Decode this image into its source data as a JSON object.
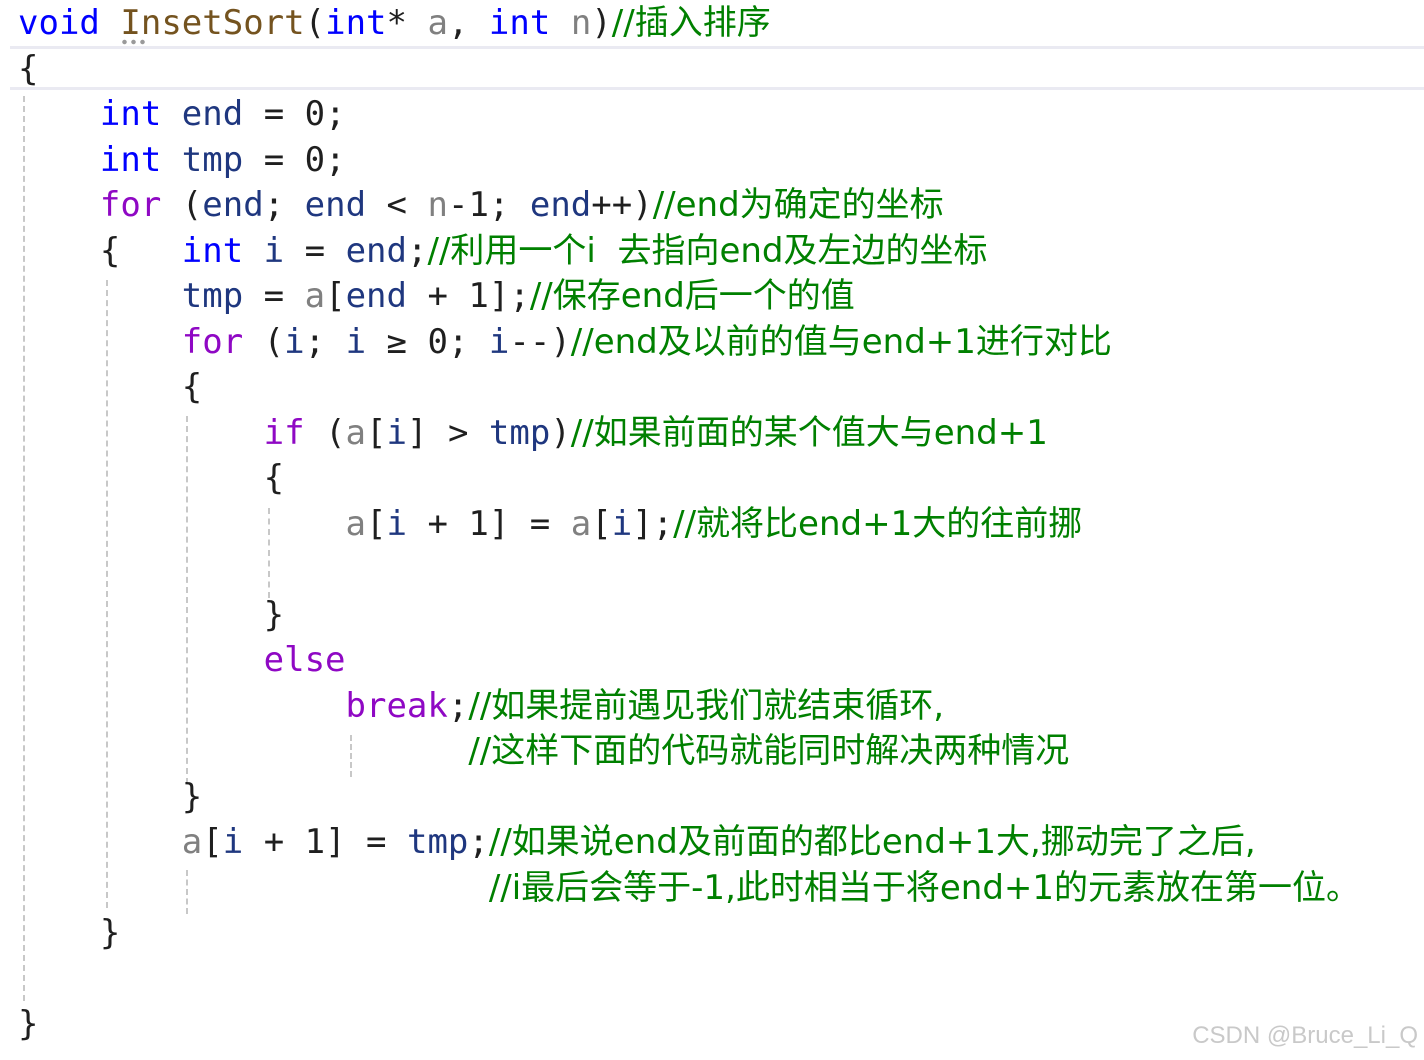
{
  "editor": {
    "language": "C",
    "colors": {
      "keyword": "#0000ff",
      "control": "#8f08c4",
      "function": "#74531f",
      "parameter": "#808080",
      "local": "#1f377f",
      "comment": "#008000",
      "current_line_border": "#eaeaf2"
    },
    "lines": [
      {
        "tokens": [
          [
            "void",
            "kw"
          ],
          [
            " ",
            "op"
          ],
          [
            "InsetSort",
            "fn"
          ],
          [
            "(",
            "op"
          ],
          [
            "int",
            "kw"
          ],
          [
            "* ",
            "op"
          ],
          [
            "a",
            "param"
          ],
          [
            ", ",
            "op"
          ],
          [
            "int",
            "kw"
          ],
          [
            " ",
            "op"
          ],
          [
            "n",
            "param"
          ],
          [
            ")",
            "op"
          ],
          [
            "//插入排序",
            "cmt"
          ]
        ]
      },
      {
        "tokens": [
          [
            "{",
            "op"
          ]
        ]
      },
      {
        "tokens": [
          [
            "    ",
            "op"
          ],
          [
            "int",
            "kw"
          ],
          [
            " ",
            "op"
          ],
          [
            "end",
            "var"
          ],
          [
            " = 0;",
            "op"
          ]
        ]
      },
      {
        "tokens": [
          [
            "    ",
            "op"
          ],
          [
            "int",
            "kw"
          ],
          [
            " ",
            "op"
          ],
          [
            "tmp",
            "var"
          ],
          [
            " = 0;",
            "op"
          ]
        ]
      },
      {
        "tokens": [
          [
            "    ",
            "op"
          ],
          [
            "for",
            "ctl"
          ],
          [
            " (",
            "op"
          ],
          [
            "end",
            "var"
          ],
          [
            "; ",
            "op"
          ],
          [
            "end",
            "var"
          ],
          [
            " < ",
            "op"
          ],
          [
            "n",
            "param"
          ],
          [
            "-1; ",
            "op"
          ],
          [
            "end",
            "var"
          ],
          [
            "++)",
            "op"
          ],
          [
            "//end为确定的坐标",
            "cmt"
          ]
        ]
      },
      {
        "tokens": [
          [
            "    {   ",
            "op"
          ],
          [
            "int",
            "kw"
          ],
          [
            " ",
            "op"
          ],
          [
            "i",
            "var"
          ],
          [
            " = ",
            "op"
          ],
          [
            "end",
            "var"
          ],
          [
            ";",
            "op"
          ],
          [
            "//利用一个i  去指向end及左边的坐标",
            "cmt"
          ]
        ]
      },
      {
        "tokens": [
          [
            "        ",
            "op"
          ],
          [
            "tmp",
            "var"
          ],
          [
            " = ",
            "op"
          ],
          [
            "a",
            "param"
          ],
          [
            "[",
            "op"
          ],
          [
            "end",
            "var"
          ],
          [
            " + 1];",
            "op"
          ],
          [
            "//保存end后一个的值",
            "cmt"
          ]
        ]
      },
      {
        "tokens": [
          [
            "        ",
            "op"
          ],
          [
            "for",
            "ctl"
          ],
          [
            " (",
            "op"
          ],
          [
            "i",
            "var"
          ],
          [
            "; ",
            "op"
          ],
          [
            "i",
            "var"
          ],
          [
            " ≥ 0; ",
            "op"
          ],
          [
            "i",
            "var"
          ],
          [
            "--)",
            "op"
          ],
          [
            "//end及以前的值与end+1进行对比",
            "cmt"
          ]
        ]
      },
      {
        "tokens": [
          [
            "        {",
            "op"
          ]
        ]
      },
      {
        "tokens": [
          [
            "            ",
            "op"
          ],
          [
            "if",
            "ctl"
          ],
          [
            " (",
            "op"
          ],
          [
            "a",
            "param"
          ],
          [
            "[",
            "op"
          ],
          [
            "i",
            "var"
          ],
          [
            "] > ",
            "op"
          ],
          [
            "tmp",
            "var"
          ],
          [
            ")",
            "op"
          ],
          [
            "//如果前面的某个值大与end+1",
            "cmt"
          ]
        ]
      },
      {
        "tokens": [
          [
            "            {",
            "op"
          ]
        ]
      },
      {
        "tokens": [
          [
            "                ",
            "op"
          ],
          [
            "a",
            "param"
          ],
          [
            "[",
            "op"
          ],
          [
            "i",
            "var"
          ],
          [
            " + 1] = ",
            "op"
          ],
          [
            "a",
            "param"
          ],
          [
            "[",
            "op"
          ],
          [
            "i",
            "var"
          ],
          [
            "];",
            "op"
          ],
          [
            "//就将比end+1大的往前挪",
            "cmt"
          ]
        ]
      },
      {
        "tokens": [
          [
            "",
            "op"
          ]
        ]
      },
      {
        "tokens": [
          [
            "            }",
            "op"
          ]
        ]
      },
      {
        "tokens": [
          [
            "            ",
            "op"
          ],
          [
            "else",
            "ctl"
          ]
        ]
      },
      {
        "tokens": [
          [
            "                ",
            "op"
          ],
          [
            "break",
            "ctl"
          ],
          [
            ";",
            "op"
          ],
          [
            "//如果提前遇见我们就结束循环,",
            "cmt"
          ]
        ]
      },
      {
        "tokens": [
          [
            "                      ",
            "op"
          ],
          [
            "//这样下面的代码就能同时解决两种情况",
            "cmt"
          ]
        ]
      },
      {
        "tokens": [
          [
            "        }",
            "op"
          ]
        ]
      },
      {
        "tokens": [
          [
            "        ",
            "op"
          ],
          [
            "a",
            "param"
          ],
          [
            "[",
            "op"
          ],
          [
            "i",
            "var"
          ],
          [
            " + 1] = ",
            "op"
          ],
          [
            "tmp",
            "var"
          ],
          [
            ";",
            "op"
          ],
          [
            "//如果说end及前面的都比end+1大,挪动完了之后,",
            "cmt"
          ]
        ]
      },
      {
        "tokens": [
          [
            "                       ",
            "op"
          ],
          [
            "//i最后会等于-1,此时相当于将end+1的元素放在第一位。",
            "cmt"
          ]
        ]
      },
      {
        "tokens": [
          [
            "    }",
            "op"
          ]
        ]
      },
      {
        "tokens": [
          [
            "",
            "op"
          ]
        ]
      },
      {
        "tokens": [
          [
            "}",
            "op"
          ]
        ]
      }
    ]
  },
  "watermark": "CSDN @Bruce_Li_Q"
}
